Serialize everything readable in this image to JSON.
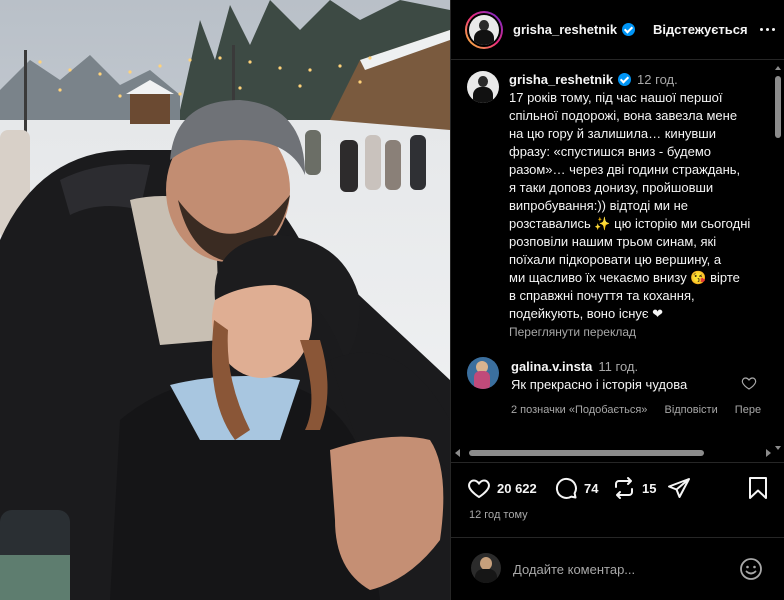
{
  "post": {
    "username": "grisha_reshetnik",
    "follow_label": "Відстежується",
    "time": "12 год.",
    "caption": "17 років тому, під час нашої першої\nспільної подорожі, вона завезла мене\nна цю гору й залишила… кинувши\nфразу: «спустишся вниз - будемо\nразом»… через дві години страждань,\nя таки доповз донизу, пройшовши\nвипробування:)) відтоді ми не\nрозставались ✨ цю історію ми сьогодні\nрозповіли нашим трьом синам, які\nпоїхали підкоровати цю вершину, а\nми щасливо їх чекаємо внизу 😘 вірте\nв справжні почуття та кохання,\nподейкують, воно існує ❤",
    "translate_label": "Переглянути переклад",
    "likes": "20 622",
    "comments_count": "74",
    "reposts": "15",
    "posted_ago": "12 год тому"
  },
  "comment": {
    "username": "galina.v.insta",
    "time": "11 год.",
    "text": "Як прекрасно і історія чудова",
    "likes_label": "2 позначки «Подобається»",
    "reply_label": "Відповісти",
    "more_label": "Пере"
  },
  "add_comment": {
    "placeholder": "Додайте коментар..."
  },
  "icons": [
    "more-icon",
    "verified-icon",
    "heart-icon",
    "comment-icon",
    "repost-icon",
    "share-icon",
    "bookmark-icon",
    "emoji-icon"
  ],
  "colors": {
    "background": "#000000",
    "verified": "#0095f6",
    "muted": "#a8a8a8"
  }
}
